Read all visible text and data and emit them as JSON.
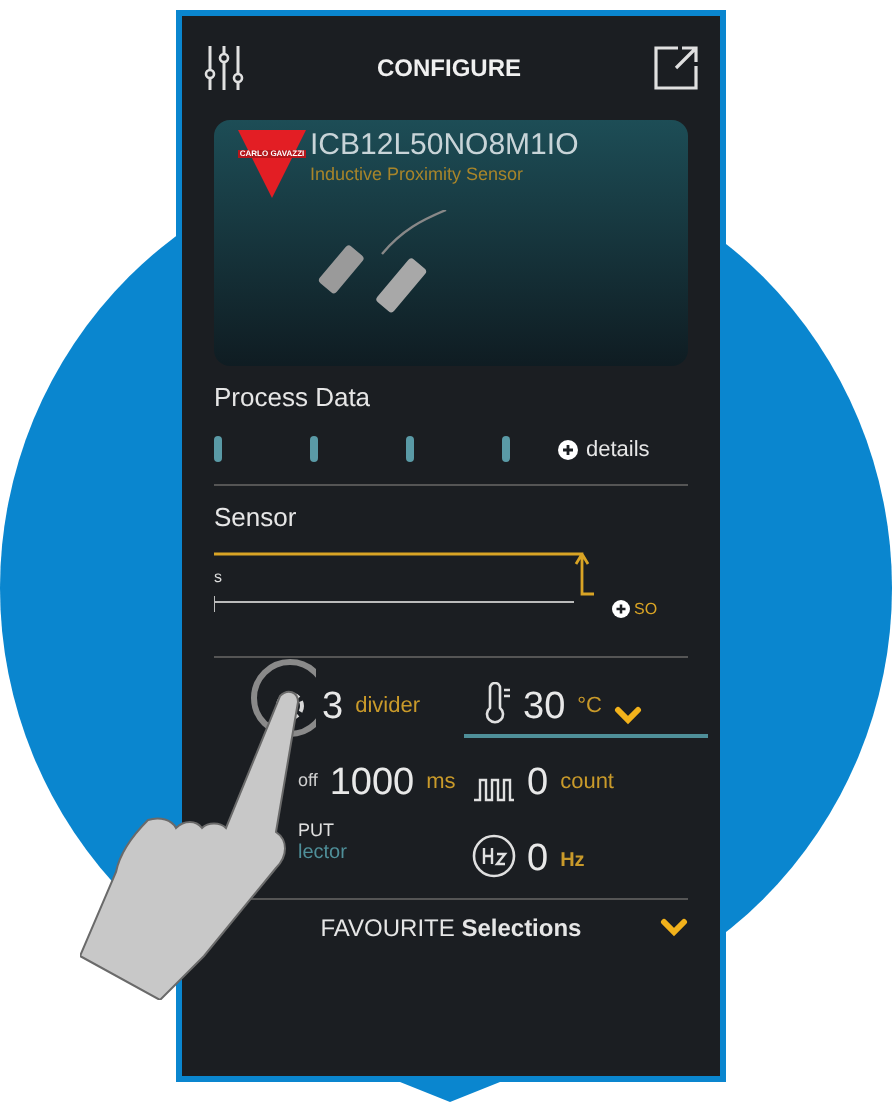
{
  "header": {
    "title": "CONFIGURE"
  },
  "product": {
    "logo_text": "CARLO GAVAZZI",
    "code": "ICB12L50NO8M1IO",
    "description": "Inductive Proximity Sensor"
  },
  "process_data": {
    "title": "Process Data",
    "details": "details"
  },
  "sensor": {
    "title": "Sensor",
    "start_label": "s",
    "end_label": "SO"
  },
  "readings": [
    {
      "kind": "divider",
      "value": "3",
      "unit": "divider",
      "selected": false
    },
    {
      "kind": "temperature",
      "value": "30",
      "unit": "°C",
      "selected": true
    },
    {
      "kind": "delay",
      "label": "off",
      "value": "1000",
      "unit": "ms",
      "selected": false
    },
    {
      "kind": "count",
      "value": "0",
      "unit": "count",
      "selected": false
    },
    {
      "kind": "output",
      "label": "PUT",
      "sublabel": "lector",
      "selected": false
    },
    {
      "kind": "frequency",
      "value": "0",
      "unit": "Hz",
      "selected": false
    }
  ],
  "footer": {
    "label": "FAVOURITE **Selections**"
  }
}
